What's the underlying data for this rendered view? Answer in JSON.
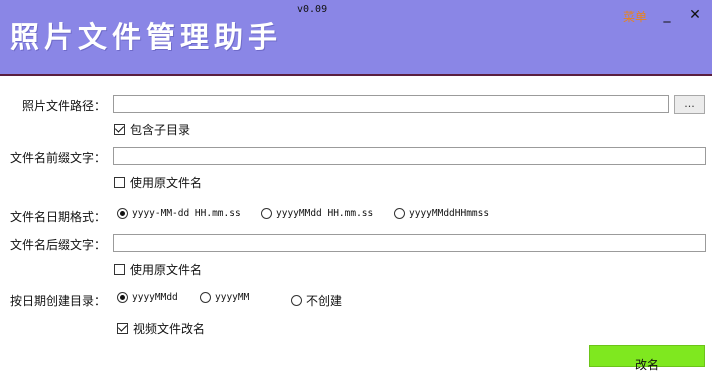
{
  "header": {
    "title": "照片文件管理助手",
    "version": "v0.09",
    "menu_label": "菜单",
    "minimize_label": "_",
    "close_label": "✕",
    "background_color": "#8a86e6"
  },
  "photo_path": {
    "label": "照片文件路径：",
    "value": "",
    "browse_label": "...",
    "include_subdir_label": "包含子目录",
    "include_subdir_checked": true
  },
  "prefix": {
    "label": "文件名前缀文字：",
    "value": "",
    "use_original_label": "使用原文件名",
    "use_original_checked": false
  },
  "date_format": {
    "label": "文件名日期格式：",
    "options": [
      "yyyy-MM-dd HH.mm.ss",
      "yyyyMMdd HH.mm.ss",
      "yyyyMMddHHmmss"
    ],
    "selected_index": 0
  },
  "suffix": {
    "label": "文件名后缀文字：",
    "value": "",
    "use_original_label": "使用原文件名",
    "use_original_checked": false
  },
  "dir_by_date": {
    "label": "按日期创建目录：",
    "options": [
      "yyyyMMdd",
      "yyyyMM",
      "不创建"
    ],
    "selected_index": 0,
    "video_rename_label": "视频文件改名",
    "video_rename_checked": true
  },
  "rename_button": {
    "label": "改名",
    "color": "#7fe81f"
  }
}
